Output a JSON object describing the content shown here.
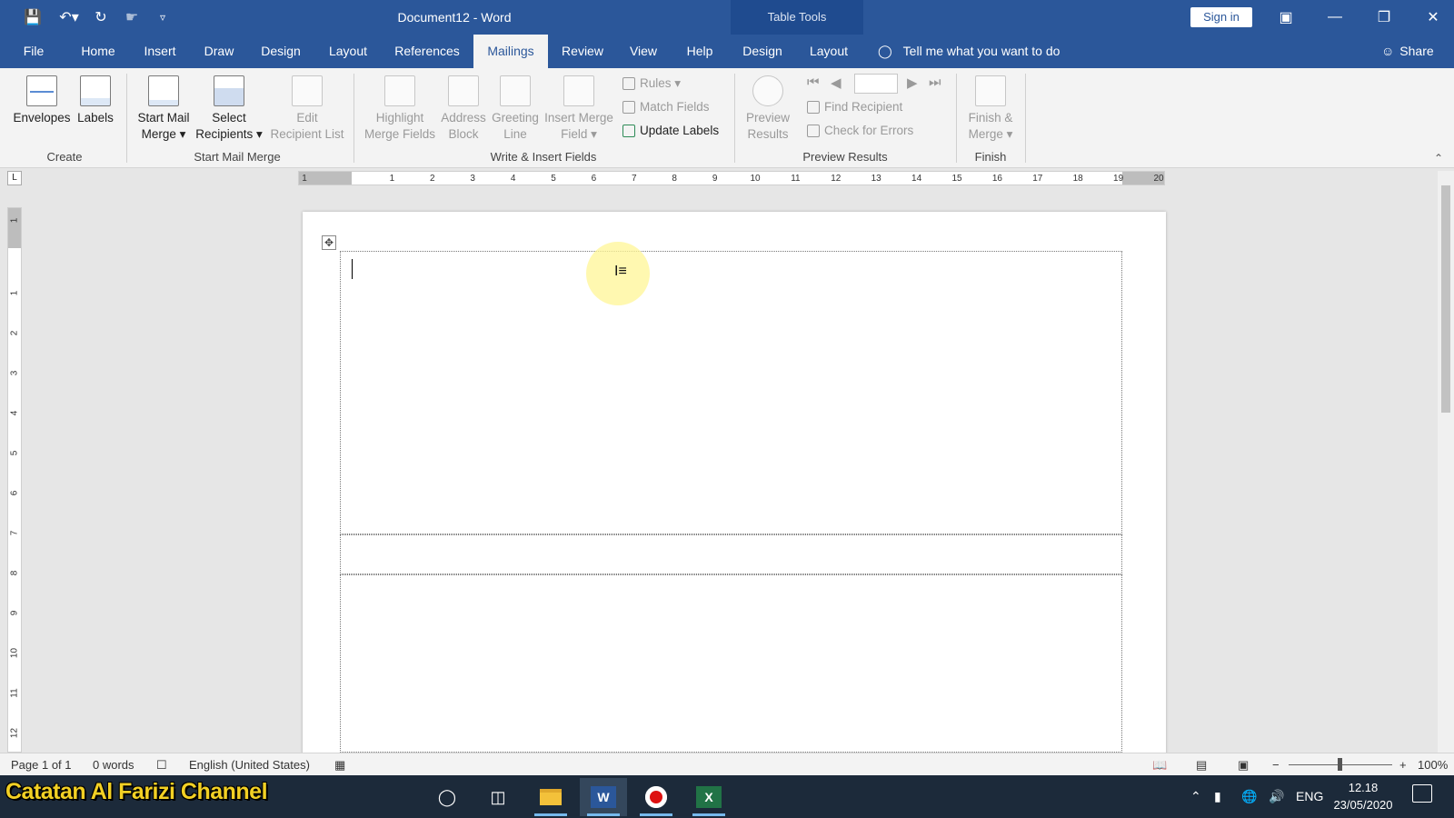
{
  "window": {
    "title": "Document12  -  Word",
    "contextual_group": "Table Tools",
    "signin_label": "Sign in",
    "share_label": "Share"
  },
  "tabs": [
    "File",
    "Home",
    "Insert",
    "Draw",
    "Design",
    "Layout",
    "References",
    "Mailings",
    "Review",
    "View",
    "Help",
    "Design",
    "Layout"
  ],
  "active_tab": "Mailings",
  "tellme": "Tell me what you want to do",
  "ribbon": {
    "create": {
      "label": "Create",
      "envelopes": "Envelopes",
      "labels": "Labels"
    },
    "start_mail_merge": {
      "label": "Start Mail Merge",
      "start_l1": "Start Mail",
      "start_l2": "Merge",
      "select_l1": "Select",
      "select_l2": "Recipients",
      "edit_l1": "Edit",
      "edit_l2": "Recipient List"
    },
    "write_insert": {
      "label": "Write & Insert Fields",
      "highlight_l1": "Highlight",
      "highlight_l2": "Merge Fields",
      "address_l1": "Address",
      "address_l2": "Block",
      "greeting_l1": "Greeting",
      "greeting_l2": "Line",
      "insert_l1": "Insert Merge",
      "insert_l2": "Field",
      "rules": "Rules",
      "match": "Match Fields",
      "update": "Update Labels"
    },
    "preview": {
      "label": "Preview Results",
      "preview_l1": "Preview",
      "preview_l2": "Results",
      "find": "Find Recipient",
      "check": "Check for Errors"
    },
    "finish": {
      "label": "Finish",
      "finish_l1": "Finish &",
      "finish_l2": "Merge"
    }
  },
  "ruler_h": [
    "1",
    "1",
    "2",
    "3",
    "4",
    "5",
    "6",
    "7",
    "8",
    "9",
    "10",
    "11",
    "12",
    "13",
    "14",
    "15",
    "16",
    "17",
    "18",
    "19",
    "20"
  ],
  "ruler_v": [
    "1",
    "1",
    "2",
    "3",
    "4",
    "5",
    "6",
    "7",
    "8",
    "9",
    "10",
    "11",
    "12"
  ],
  "status": {
    "page": "Page 1 of 1",
    "words": "0 words",
    "language": "English (United States)",
    "zoom": "100%"
  },
  "taskbar": {
    "channel": "Catatan Al Farizi Channel",
    "lang": "ENG",
    "time": "12.18",
    "date": "23/05/2020"
  }
}
